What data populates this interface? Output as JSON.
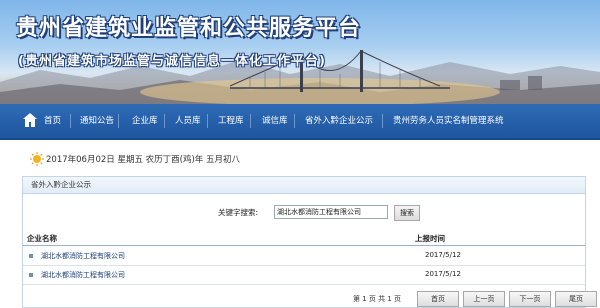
{
  "header": {
    "title": "贵州省建筑业监管和公共服务平台",
    "subtitle": "(贵州省建筑市场监管与诚信信息一体化工作平台)"
  },
  "nav": {
    "items": [
      {
        "label": "首页"
      },
      {
        "label": "通知公告"
      },
      {
        "label": "企业库"
      },
      {
        "label": "人员库"
      },
      {
        "label": "工程库"
      },
      {
        "label": "诚信库"
      },
      {
        "label": "省外入黔企业公示"
      },
      {
        "label": "贵州劳务人员实名制管理系统"
      }
    ]
  },
  "date_line": {
    "text": "2017年06月02日 星期五 农历丁酉(鸡)年 五月初八"
  },
  "panel": {
    "title": "省外入黔企业公示",
    "search": {
      "label": "关键字搜索:",
      "value": "湖北水都消防工程有限公司",
      "button": "搜索"
    },
    "columns": {
      "company": "企业名称",
      "date": "上报时间"
    },
    "rows": [
      {
        "company": "湖北水都消防工程有限公司",
        "date": "2017/5/12"
      },
      {
        "company": "湖北水都消防工程有限公司",
        "date": "2017/5/12"
      }
    ],
    "pager": {
      "info": "第 1 页 共 1 页",
      "first": "首页",
      "prev": "上一页",
      "next": "下一页",
      "last": "尾页"
    }
  },
  "colors": {
    "nav_bg": "#1f56a0",
    "title_outline": "#1f3e7a",
    "link": "#1b3f78"
  }
}
